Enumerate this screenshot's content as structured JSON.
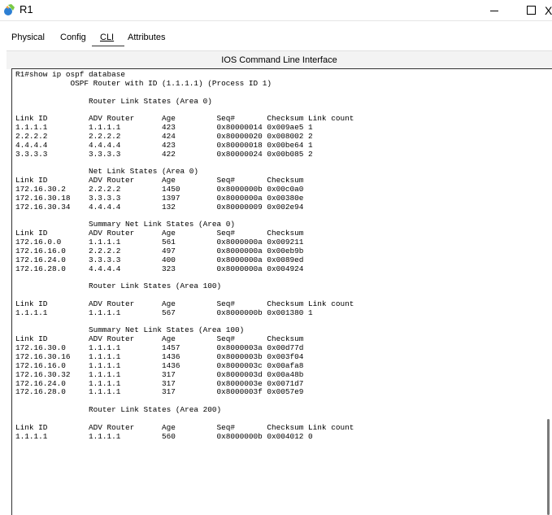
{
  "window": {
    "title": "R1",
    "icon": "router-icon",
    "close_symbol": "X"
  },
  "tabs": [
    {
      "label": "Physical"
    },
    {
      "label": "Config"
    },
    {
      "label": "CLI"
    },
    {
      "label": "Attributes"
    }
  ],
  "header": {
    "title": "IOS Command Line Interface"
  },
  "console": {
    "lines": [
      "R1#show ip ospf database",
      "            OSPF Router with ID (1.1.1.1) (Process ID 1)",
      "",
      "                Router Link States (Area 0)",
      "",
      "Link ID         ADV Router      Age         Seq#       Checksum Link count",
      "1.1.1.1         1.1.1.1         423         0x80000014 0x009ae5 1",
      "2.2.2.2         2.2.2.2         424         0x80000020 0x008002 2",
      "4.4.4.4         4.4.4.4         423         0x80000018 0x00be64 1",
      "3.3.3.3         3.3.3.3         422         0x80000024 0x00b085 2",
      "",
      "                Net Link States (Area 0)",
      "Link ID         ADV Router      Age         Seq#       Checksum",
      "172.16.30.2     2.2.2.2         1450        0x8000000b 0x00c0a0",
      "172.16.30.18    3.3.3.3         1397        0x8000000a 0x00380e",
      "172.16.30.34    4.4.4.4         132         0x80000009 0x002e94",
      "",
      "                Summary Net Link States (Area 0)",
      "Link ID         ADV Router      Age         Seq#       Checksum",
      "172.16.0.0      1.1.1.1         561         0x8000000a 0x009211",
      "172.16.16.0     2.2.2.2         497         0x8000000a 0x00eb9b",
      "172.16.24.0     3.3.3.3         400         0x8000000a 0x0089ed",
      "172.16.28.0     4.4.4.4         323         0x8000000a 0x004924",
      "",
      "                Router Link States (Area 100)",
      "",
      "Link ID         ADV Router      Age         Seq#       Checksum Link count",
      "1.1.1.1         1.1.1.1         567         0x8000000b 0x001380 1",
      "",
      "                Summary Net Link States (Area 100)",
      "Link ID         ADV Router      Age         Seq#       Checksum",
      "172.16.30.0     1.1.1.1         1457        0x8000003a 0x00d77d",
      "172.16.30.16    1.1.1.1         1436        0x8000003b 0x003f04",
      "172.16.16.0     1.1.1.1         1436        0x8000003c 0x00afa8",
      "172.16.30.32    1.1.1.1         317         0x8000003d 0x00a48b",
      "172.16.24.0     1.1.1.1         317         0x8000003e 0x0071d7",
      "172.16.28.0     1.1.1.1         317         0x8000003f 0x0057e9",
      "",
      "                Router Link States (Area 200)",
      "",
      "Link ID         ADV Router      Age         Seq#       Checksum Link count",
      "1.1.1.1         1.1.1.1         560         0x8000000b 0x004012 0"
    ]
  }
}
